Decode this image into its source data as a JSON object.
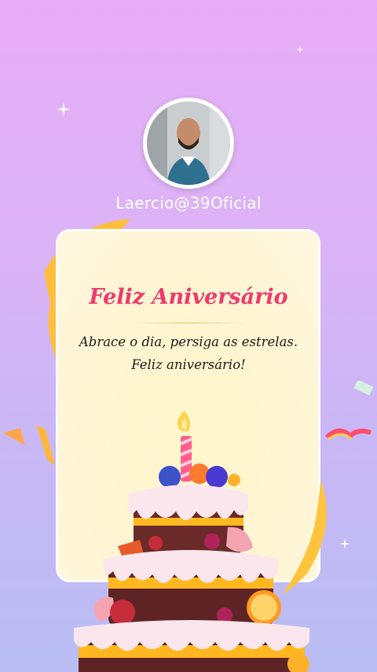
{
  "profile": {
    "username": "Laercio@39Oficial"
  },
  "card": {
    "title": "Feliz Aniversário",
    "message": "Abrace o dia, persiga as estrelas. Feliz aniversário!"
  },
  "colors": {
    "title": "#f0386b",
    "background_top": "#e7adf6",
    "background_bottom": "#b9bdf4",
    "card": "#fff6d6"
  },
  "icons": [
    "sparkle-icon",
    "ribbon-icon",
    "confetti-icon",
    "birthday-cake-icon",
    "candle-icon"
  ]
}
